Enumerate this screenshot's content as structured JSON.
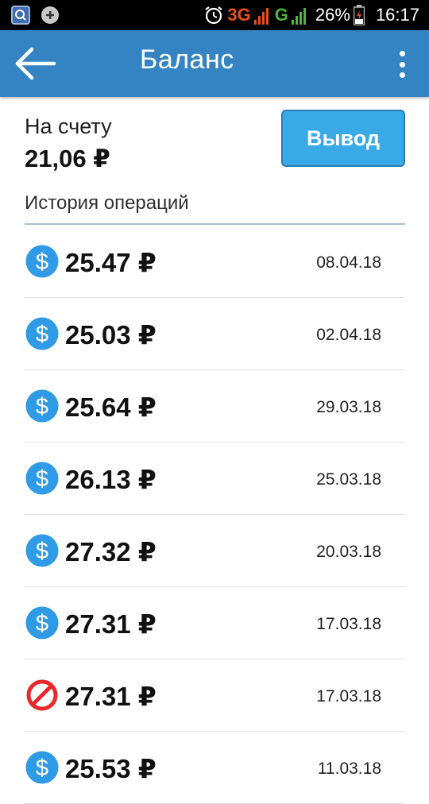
{
  "status_bar": {
    "network_type": "3G",
    "network_type_2": "G",
    "battery": "26%",
    "time": "16:17",
    "icons": [
      "app-notification-icon",
      "plus-notification-icon",
      "alarm-icon",
      "signal-icon",
      "battery-icon"
    ]
  },
  "app_bar": {
    "title": "Баланс",
    "back_icon": "arrow-left-icon",
    "menu_icon": "more-vertical-icon",
    "color": "#3484c4"
  },
  "balance": {
    "label": "На счету",
    "value": "21,06 ₽"
  },
  "withdraw_button": {
    "label": "Вывод",
    "color": "#3aaae6"
  },
  "history": {
    "title": "История операций",
    "operations": [
      {
        "type": "dollar",
        "amount": "25.47 ₽",
        "date": "08.04.18"
      },
      {
        "type": "dollar",
        "amount": "25.03 ₽",
        "date": "02.04.18"
      },
      {
        "type": "dollar",
        "amount": "25.64 ₽",
        "date": "29.03.18"
      },
      {
        "type": "dollar",
        "amount": "26.13 ₽",
        "date": "25.03.18"
      },
      {
        "type": "dollar",
        "amount": "27.32 ₽",
        "date": "20.03.18"
      },
      {
        "type": "dollar",
        "amount": "27.31 ₽",
        "date": "17.03.18"
      },
      {
        "type": "cancelled",
        "amount": "27.31 ₽",
        "date": "17.03.18"
      },
      {
        "type": "dollar",
        "amount": "25.53 ₽",
        "date": "11.03.18"
      }
    ]
  },
  "colors": {
    "dollar_icon": "#2f9ae6",
    "cancelled_icon": "#e8282b"
  }
}
